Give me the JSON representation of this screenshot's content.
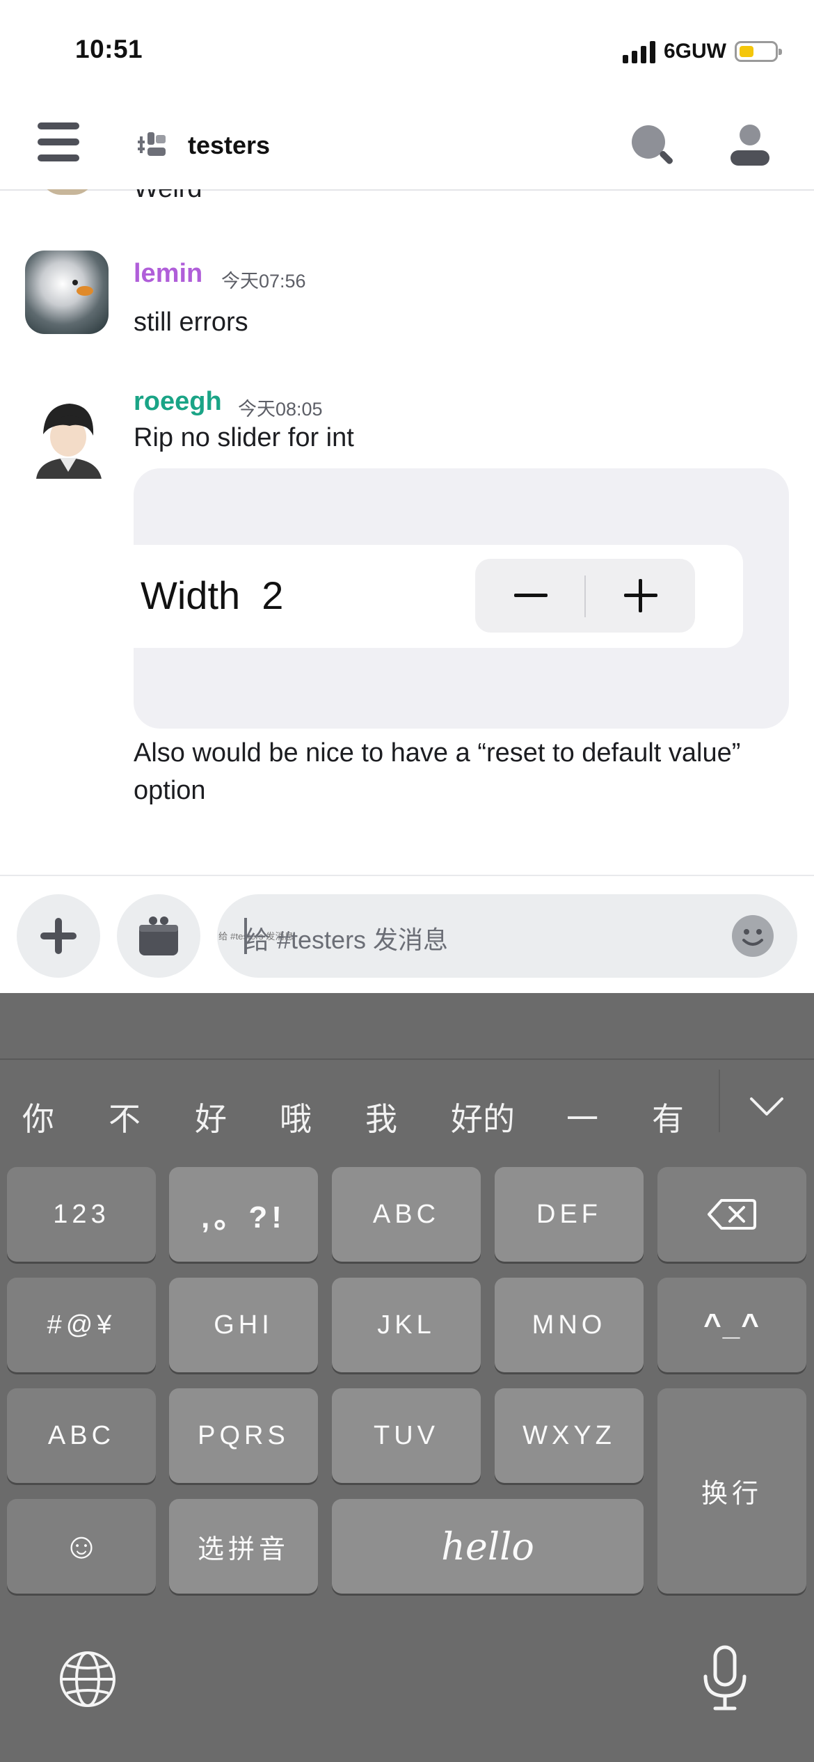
{
  "status_bar": {
    "time": "10:51",
    "network": "6GUW",
    "battery_level": 0.4,
    "battery_color": "#f4c60b"
  },
  "header": {
    "channel_name": "testers",
    "menu_icon": "hamburger-icon",
    "channel_icon": "channel-threads-icon",
    "search_icon": "search-icon",
    "profile_icon": "person-icon"
  },
  "messages": {
    "partial": {
      "text": "Weird"
    },
    "items": [
      {
        "author": "lemin",
        "author_color": "#b05ed9",
        "time": "今天07:56",
        "lines": [
          "still errors"
        ]
      },
      {
        "author": "roeegh",
        "author_color": "#1aa486",
        "time": "今天08:05",
        "lines": [
          "Rip no slider for int"
        ],
        "embed": {
          "label": "Width",
          "value": "2",
          "minus": "−",
          "plus": "+"
        },
        "after_lines": [
          "Also would be nice to have a “reset to default value”",
          "option"
        ]
      }
    ]
  },
  "composer": {
    "placeholder": "给 #testers 发消息",
    "add_icon": "plus-icon",
    "gift_icon": "gift-icon",
    "emoji_icon": "emoji-icon"
  },
  "keyboard": {
    "candidates": [
      "你",
      "不",
      "好",
      "哦",
      "我",
      "好的",
      "一",
      "有"
    ],
    "collapse_icon": "chevron-down-icon",
    "rows": [
      [
        "123",
        ",。?!",
        "ABC",
        "DEF",
        "⌫"
      ],
      [
        "#@¥",
        "GHI",
        "JKL",
        "MNO",
        "^_^"
      ],
      [
        "ABC",
        "PQRS",
        "TUV",
        "WXYZ",
        "换行"
      ],
      [
        "☺",
        "选拼音",
        "hello"
      ]
    ],
    "globe_icon": "globe-icon",
    "mic_icon": "microphone-icon"
  }
}
